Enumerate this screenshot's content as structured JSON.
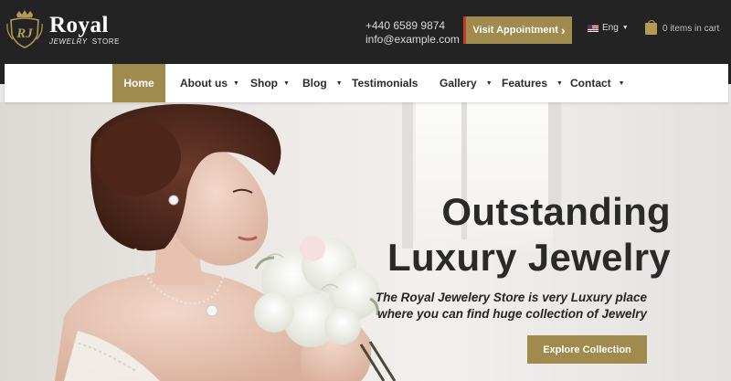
{
  "brand": {
    "monogram": "RJ",
    "name": "Royal",
    "sub_left": "JEWELRY",
    "sub_right": "STORE"
  },
  "contact": {
    "phone": "+440 6589 9874",
    "email": "info@example.com"
  },
  "header": {
    "appointment_label": "Visit Appointment",
    "appointment_arrow": "›",
    "language": "Eng",
    "cart_label": "0 items in cart"
  },
  "nav": {
    "items": [
      {
        "label": "Home",
        "dropdown": false,
        "active": true
      },
      {
        "label": "About us",
        "dropdown": true
      },
      {
        "label": "Shop",
        "dropdown": true
      },
      {
        "label": "Blog",
        "dropdown": true
      },
      {
        "label": "Testimonials",
        "dropdown": false
      },
      {
        "label": "Gallery",
        "dropdown": true
      },
      {
        "label": "Features",
        "dropdown": true
      },
      {
        "label": "Contact",
        "dropdown": true
      }
    ],
    "dropdown_glyph": "▼"
  },
  "hero": {
    "title_line1": "Outstanding",
    "title_line2": "Luxury Jewelry",
    "desc_line1": "The Royal Jewelery Store is very Luxury place",
    "desc_line2": "where you can find huge collection of Jewelry",
    "cta_label": "Explore Collection"
  },
  "colors": {
    "topbar": "#232323",
    "accent_gold": "#a08a4e",
    "appointment_stripe": "#c23a2b",
    "nav_bg": "#ffffff",
    "text_dark": "#2a2a2a"
  },
  "icons": [
    "crest-logo-icon",
    "us-flag-icon",
    "shopping-bag-icon",
    "chevron-down-icon",
    "chevron-right-icon"
  ]
}
